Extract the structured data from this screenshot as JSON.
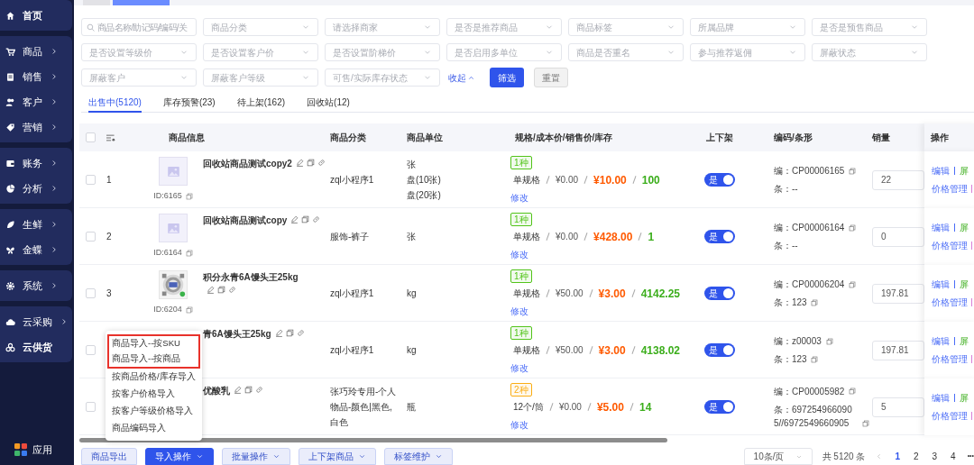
{
  "sidebar": {
    "groups": [
      {
        "items": [
          {
            "label": "首页",
            "has_arrow": false,
            "bold": true
          }
        ]
      },
      {
        "items": [
          {
            "label": "商品",
            "has_arrow": true,
            "bold": false
          },
          {
            "label": "销售",
            "has_arrow": true,
            "bold": false
          },
          {
            "label": "客户",
            "has_arrow": true,
            "bold": false
          },
          {
            "label": "营销",
            "has_arrow": true,
            "bold": false
          }
        ]
      },
      {
        "items": [
          {
            "label": "账务",
            "has_arrow": true,
            "bold": false
          },
          {
            "label": "分析",
            "has_arrow": true,
            "bold": false
          }
        ]
      },
      {
        "items": [
          {
            "label": "生鲜",
            "has_arrow": true,
            "bold": false
          },
          {
            "label": "金蝶",
            "has_arrow": true,
            "bold": false
          }
        ]
      },
      {
        "items": [
          {
            "label": "系统",
            "has_arrow": true,
            "bold": false
          }
        ]
      },
      {
        "items": [
          {
            "label": "云采购",
            "has_arrow": true,
            "bold": false
          },
          {
            "label": "云供货",
            "has_arrow": false,
            "bold": true
          }
        ]
      }
    ],
    "app": {
      "label": "应用"
    }
  },
  "filters": [
    [
      {
        "kind": "search",
        "placeholder": "商品名称/助记码/编码/关"
      },
      {
        "kind": "select",
        "placeholder": "商品分类"
      },
      {
        "kind": "select",
        "placeholder": "请选择商家"
      },
      {
        "kind": "select",
        "placeholder": "是否是推荐商品"
      },
      {
        "kind": "select",
        "placeholder": "商品标签"
      },
      {
        "kind": "select",
        "placeholder": "所属品牌"
      },
      {
        "kind": "select",
        "placeholder": "是否是预售商品"
      }
    ],
    [
      {
        "kind": "select",
        "placeholder": "是否设置等级价"
      },
      {
        "kind": "select",
        "placeholder": "是否设置客户价"
      },
      {
        "kind": "select",
        "placeholder": "是否设置阶梯价"
      },
      {
        "kind": "select",
        "placeholder": "是否启用多单位"
      },
      {
        "kind": "select",
        "placeholder": "商品是否重名"
      },
      {
        "kind": "select",
        "placeholder": "参与推荐返佣"
      },
      {
        "kind": "select",
        "placeholder": "屏蔽状态"
      }
    ],
    [
      {
        "kind": "select",
        "placeholder": "屏蔽客户"
      },
      {
        "kind": "select",
        "placeholder": "屏蔽客户等级"
      },
      {
        "kind": "select",
        "placeholder": "可售/实际库存状态"
      }
    ]
  ],
  "filter_actions": {
    "collapse": "收起",
    "filter": "筛选",
    "reset": "重置"
  },
  "tabs": [
    {
      "label": "出售中(5120)",
      "selected": true
    },
    {
      "label": "库存预警(23)",
      "selected": false
    },
    {
      "label": "待上架(162)",
      "selected": false
    },
    {
      "label": "回收站(12)",
      "selected": false
    }
  ],
  "table": {
    "all_checked": false,
    "columns": [
      "商品信息",
      "商品分类",
      "商品单位",
      "规格/成本价/销售价/库存",
      "上下架",
      "编码/条形",
      "销量",
      "操作"
    ],
    "rows": [
      {
        "index": "1",
        "kind": "placeholder",
        "checked": false,
        "name": "回收站商品测试copy2",
        "id": "ID:6165",
        "category": "zql小程序1",
        "units": [
          "张",
          "盘(10张)",
          "盘(20张)"
        ],
        "spec_tag": {
          "label": "1种",
          "color": "#52c41a"
        },
        "spec": "单规格",
        "cost": "¥0.00",
        "price": "¥10.00",
        "stock": "100",
        "modify": "修改",
        "on_shelf": true,
        "toggle_label": "是",
        "code": "编：CP00006165",
        "barcode": "条：--",
        "barcode_copy": false,
        "sales": "22",
        "edit": "编辑",
        "block": "屏",
        "price_manage": "价格管理"
      },
      {
        "index": "2",
        "kind": "placeholder",
        "checked": false,
        "name": "回收站商品测试copy",
        "id": "ID:6164",
        "category": "服饰-裤子",
        "units": [
          "张"
        ],
        "spec_tag": {
          "label": "1种",
          "color": "#52c41a"
        },
        "spec": "单规格",
        "cost": "¥0.00",
        "price": "¥428.00",
        "stock": "1",
        "modify": "修改",
        "on_shelf": true,
        "toggle_label": "是",
        "code": "编：CP00006164",
        "barcode": "条：--",
        "barcode_copy": false,
        "sales": "0",
        "edit": "编辑",
        "block": "屏",
        "price_manage": "价格管理"
      },
      {
        "index": "3",
        "kind": "picture",
        "checked": false,
        "name": "积分永青6A馒头王25kg",
        "id": "ID:6204",
        "category": "zql小程序1",
        "units": [
          "kg"
        ],
        "spec_tag": {
          "label": "1种",
          "color": "#52c41a"
        },
        "spec": "单规格",
        "cost": "¥50.00",
        "price": "¥3.00",
        "stock": "4142.25",
        "modify": "修改",
        "on_shelf": true,
        "toggle_label": "是",
        "code": "编：CP00006204",
        "barcode": "条：123",
        "barcode_copy": true,
        "sales": "197.81",
        "edit": "编辑",
        "block": "屏",
        "price_manage": "价格管理"
      },
      {
        "checked": false,
        "name": "青6A馒头王25kg",
        "category": "zql小程序1",
        "units": [
          "kg"
        ],
        "spec_tag": {
          "label": "1种",
          "color": "#52c41a"
        },
        "spec": "单规格",
        "cost": "¥50.00",
        "price": "¥3.00",
        "stock": "4138.02",
        "modify": "修改",
        "on_shelf": true,
        "toggle_label": "是",
        "code": "编：z00003",
        "barcode": "条：123",
        "barcode_copy": true,
        "sales": "197.81",
        "edit": "编辑",
        "block": "屏",
        "price_manage": "价格管理"
      },
      {
        "checked": false,
        "name": "优酸乳",
        "category": "张巧玲专用-个人物品-颜色|黑色,白色",
        "units": [
          "瓶"
        ],
        "spec_tag": {
          "label": "2种",
          "color": "#faad14"
        },
        "spec": "12个/筒",
        "cost": "¥0.00",
        "price": "¥5.00",
        "stock": "14",
        "modify": "修改",
        "on_shelf": true,
        "toggle_label": "是",
        "code": "编：CP00005982",
        "barcode": "条：6972549660905//6972549660905",
        "barcode_copy": true,
        "sales": "5",
        "edit": "编辑",
        "block": "屏",
        "price_manage": "价格管理"
      }
    ]
  },
  "import_menu": [
    {
      "label": "商品导入--按SKU",
      "highlighted": true
    },
    {
      "label": "商品导入--按商品",
      "highlighted": true
    },
    {
      "label": "按商品价格/库存导入",
      "highlighted": false
    },
    {
      "label": "按客户价格导入",
      "highlighted": false
    },
    {
      "label": "按客户等级价格导入",
      "highlighted": false
    },
    {
      "label": "商品编码导入",
      "highlighted": false
    }
  ],
  "bottom_buttons": [
    {
      "label": "商品导出",
      "primary": false,
      "caret": false
    },
    {
      "label": "导入操作",
      "primary": true,
      "caret": true
    },
    {
      "label": "批量操作",
      "primary": false,
      "caret": true
    },
    {
      "label": "上下架商品",
      "primary": false,
      "caret": true
    },
    {
      "label": "标签维护",
      "primary": false,
      "caret": true
    }
  ],
  "pagination": {
    "page_size": "10条/页",
    "total": "共 5120 条",
    "pages": [
      {
        "label": "1",
        "selected": true
      },
      {
        "label": "2",
        "selected": false
      },
      {
        "label": "3",
        "selected": false
      },
      {
        "label": "4",
        "selected": false
      }
    ],
    "more": "•••"
  }
}
